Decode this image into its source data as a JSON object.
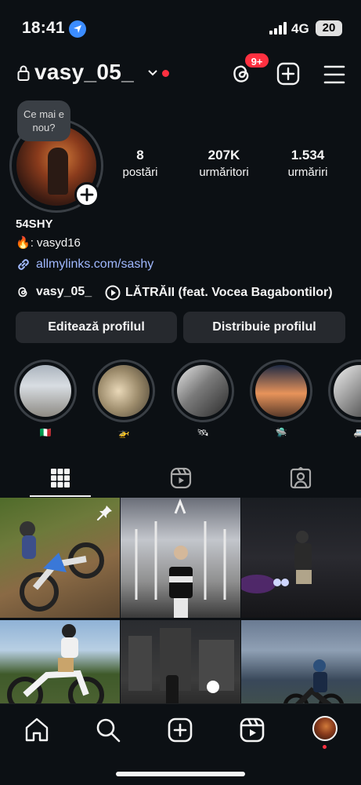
{
  "status_bar": {
    "time": "18:41",
    "network": "4G",
    "battery": "20"
  },
  "header": {
    "username": "vasy_05_",
    "notification_badge": "9+"
  },
  "profile": {
    "note": "Ce mai e nou?",
    "stats": [
      {
        "value": "8",
        "label": "postări"
      },
      {
        "value": "207K",
        "label": "urmăritori"
      },
      {
        "value": "1.534",
        "label": "urmăriri"
      }
    ],
    "display_name": "54SHY",
    "bio_emoji": "🔥",
    "bio_text": ": vasyd16",
    "link": "allmylinks.com/sashy",
    "threads_handle": "vasy_05_",
    "music": "LĂTRĂII (feat. Vocea Bagabontilor)"
  },
  "buttons": {
    "edit": "Editează profilul",
    "share": "Distribuie profilul"
  },
  "highlights": [
    {
      "label": "🇮🇹"
    },
    {
      "label": "🚁"
    },
    {
      "label": "🛰"
    },
    {
      "label": "🛸"
    },
    {
      "label": "🚐"
    }
  ],
  "colors": {
    "background": "#0c1014",
    "button": "#26292e",
    "accent_red": "#ff3040",
    "link": "#a0b8ff"
  },
  "icons": {
    "header": [
      "lock-icon",
      "chevron-down-icon",
      "threads-icon",
      "plus-square-icon",
      "menu-icon"
    ],
    "tabs": [
      "grid-icon",
      "reels-icon",
      "tagged-icon"
    ],
    "nav": [
      "home-icon",
      "search-icon",
      "create-icon",
      "reels-icon",
      "profile-avatar"
    ]
  }
}
